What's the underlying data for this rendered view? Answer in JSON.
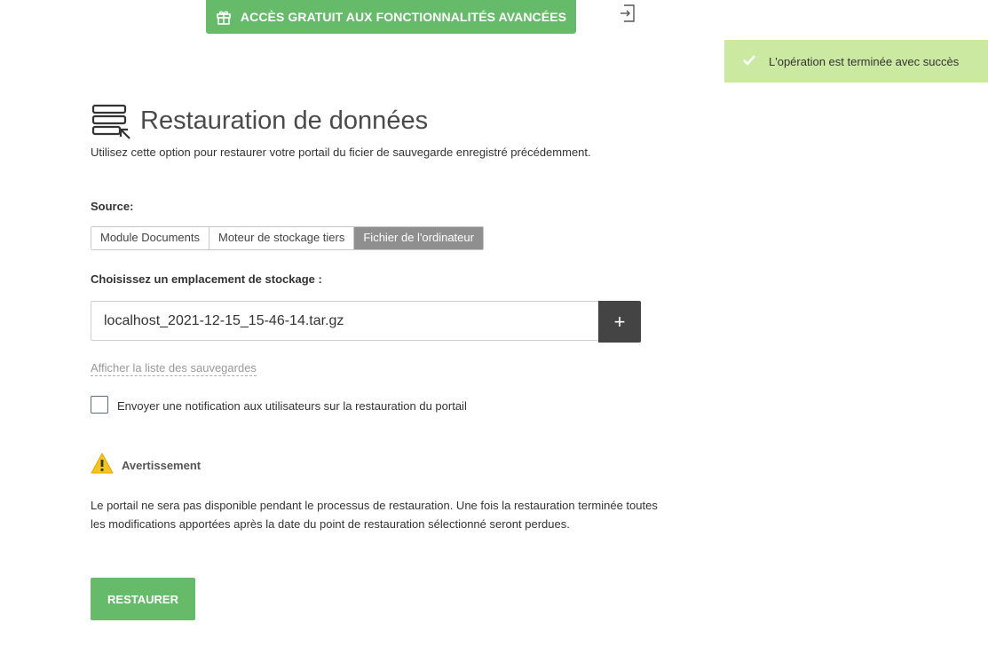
{
  "promo": {
    "label": "ACCÈS GRATUIT AUX FONCTIONNALITÉS AVANCÉES",
    "icon": "gift-icon"
  },
  "toast": {
    "message": "L'opération est terminée avec succès",
    "icon": "check-icon",
    "color": "#cbe9a0"
  },
  "page": {
    "title": "Restauration de données",
    "icon": "restore-database-icon",
    "description": "Utilisez cette option pour restaurer votre portail du ficier de sauvegarde enregistré précédemment."
  },
  "source": {
    "label": "Source:",
    "options": [
      "Module Documents",
      "Moteur de stockage tiers",
      "Fichier de l'ordinateur"
    ],
    "selected": "Fichier de l'ordinateur"
  },
  "storage": {
    "label": "Choisissez un emplacement de stockage :",
    "value": "localhost_2021-12-15_15-46-14.tar.gz",
    "add_label": "+"
  },
  "backups_link": "Afficher la liste des sauvegardes",
  "notify": {
    "label": "Envoyer une notification aux utilisateurs sur la restauration du portail",
    "checked": false
  },
  "warning": {
    "title": "Avertissement",
    "text": "Le portail ne sera pas disponible pendant le processus de restauration. Une fois la restauration terminée toutes les modifications apportées après la date du point de restauration sélectionné seront perdues."
  },
  "restore_button": "RESTAURER",
  "colors": {
    "accent": "#66bb6a",
    "dark_button": "#444444",
    "warning": "#f5c518"
  }
}
